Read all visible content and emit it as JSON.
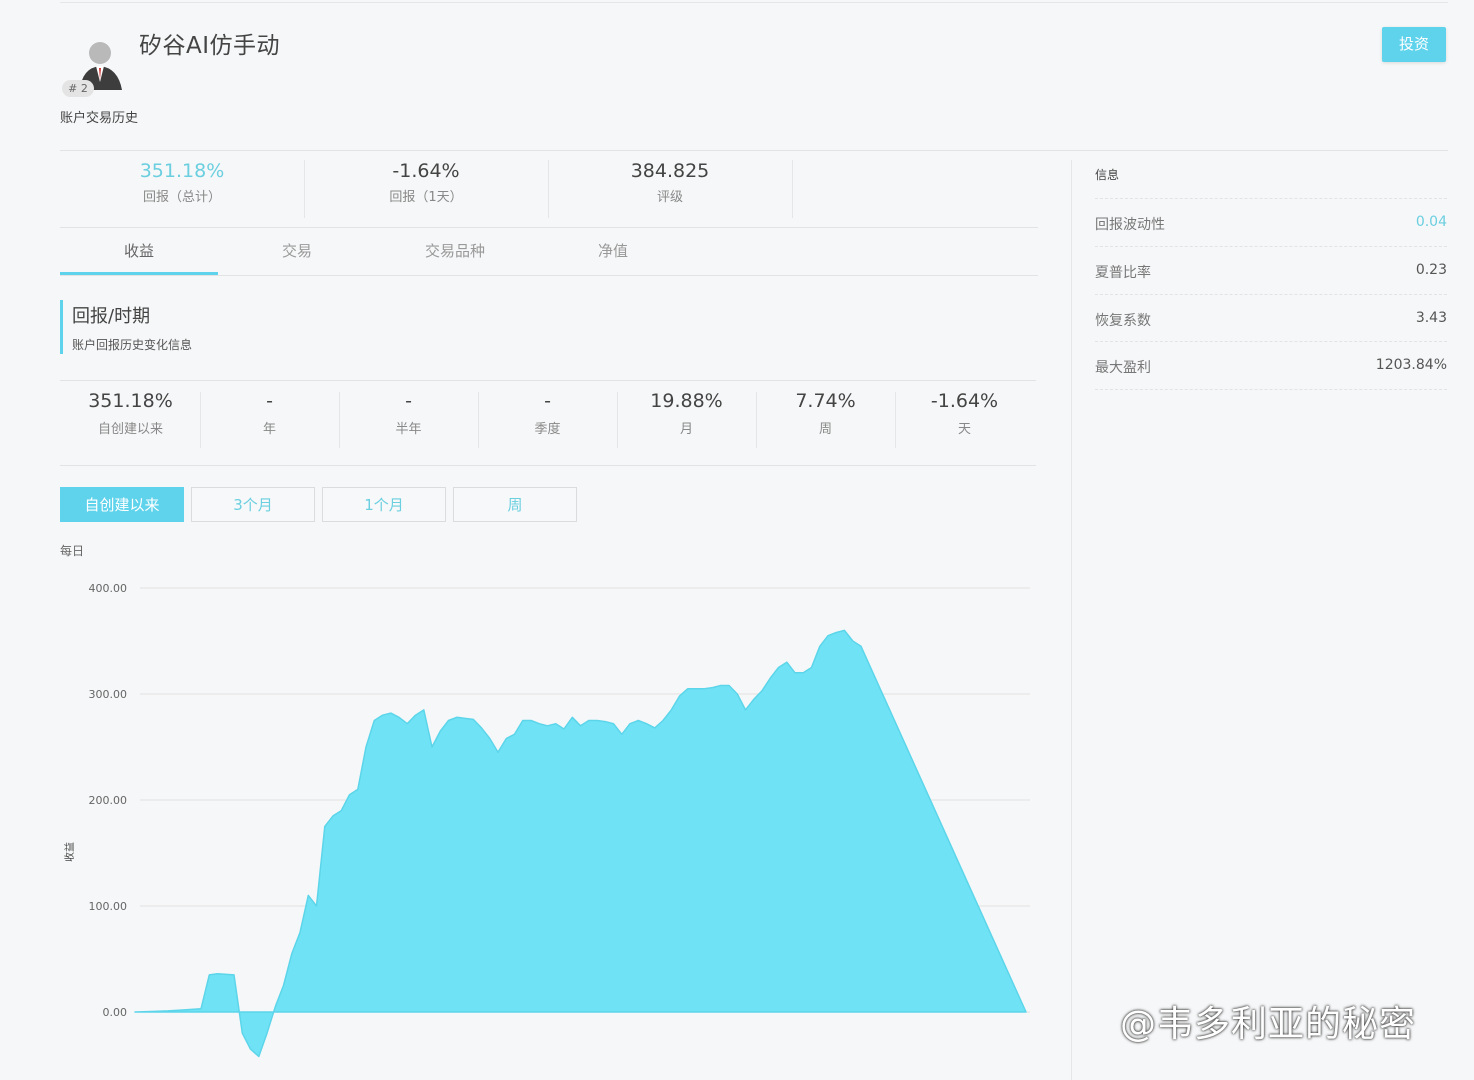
{
  "header": {
    "account_name": "矽谷AI仿手动",
    "rank": "# 2",
    "subtitle": "账户交易历史",
    "invest_label": "投资"
  },
  "stats": [
    {
      "value": "351.18%",
      "label": "回报（总计）"
    },
    {
      "value": "-1.64%",
      "label": "回报（1天）"
    },
    {
      "value": "384.825",
      "label": "评级"
    }
  ],
  "tabs": [
    "收益",
    "交易",
    "交易品种",
    "净值"
  ],
  "section": {
    "title": "回报/时期",
    "subtitle": "账户回报历史变化信息"
  },
  "periods": [
    {
      "value": "351.18%",
      "label": "自创建以来"
    },
    {
      "value": "-",
      "label": "年"
    },
    {
      "value": "-",
      "label": "半年"
    },
    {
      "value": "-",
      "label": "季度"
    },
    {
      "value": "19.88%",
      "label": "月"
    },
    {
      "value": "7.74%",
      "label": "周"
    },
    {
      "value": "-1.64%",
      "label": "天"
    }
  ],
  "range_buttons": [
    "自创建以来",
    "3个月",
    "1个月",
    "周"
  ],
  "chart_caption": "每日",
  "info": {
    "title": "信息",
    "rows": [
      {
        "key": "回报波动性",
        "value": "0.04"
      },
      {
        "key": "夏普比率",
        "value": "0.23"
      },
      {
        "key": "恢复系数",
        "value": "3.43"
      },
      {
        "key": "最大盈利",
        "value": "1203.84%"
      }
    ]
  },
  "watermark": "@韦多利亚的秘密",
  "colors": {
    "accent": "#5fd3ec",
    "fill": "#6fe3f5"
  },
  "chart_data": {
    "type": "area",
    "title": "",
    "xlabel": "",
    "ylabel": "收益",
    "ylim": [
      0,
      400
    ],
    "y_ticks": [
      "400.00",
      "300.00",
      "200.00",
      "100.00",
      "0.00"
    ],
    "grid": true,
    "x": [
      0,
      10,
      20,
      30,
      40,
      45,
      50,
      60,
      65,
      70,
      75,
      80,
      85,
      90,
      95,
      100,
      105,
      110,
      115,
      120,
      125,
      130,
      135,
      140,
      145,
      150,
      155,
      160,
      165,
      170,
      175,
      180,
      185,
      190,
      195,
      200,
      205,
      210,
      215,
      220,
      225,
      230,
      235,
      240,
      245,
      250,
      255,
      260,
      265,
      270,
      275,
      280,
      285,
      290,
      295,
      300,
      305,
      310,
      315,
      320,
      325,
      330,
      335,
      340,
      345,
      350,
      355,
      360,
      365,
      370,
      375,
      380,
      385,
      390,
      395,
      400,
      405,
      410,
      415,
      420,
      425,
      430,
      435,
      440,
      445,
      450,
      455,
      460,
      465,
      470,
      475,
      480,
      485,
      490,
      495,
      500,
      505,
      510,
      515,
      520,
      525,
      530,
      535,
      540
    ],
    "values": [
      0,
      0.5,
      1,
      2,
      3,
      35,
      36,
      35,
      -20,
      -35,
      -42,
      -20,
      5,
      25,
      55,
      75,
      110,
      100,
      175,
      185,
      190,
      205,
      210,
      250,
      275,
      280,
      282,
      278,
      272,
      280,
      285,
      250,
      265,
      275,
      278,
      277,
      276,
      268,
      258,
      245,
      258,
      262,
      275,
      275,
      272,
      270,
      272,
      267,
      278,
      270,
      275,
      275,
      274,
      272,
      262,
      272,
      275,
      272,
      268,
      275,
      285,
      298,
      305,
      305,
      305,
      306,
      308,
      308,
      300,
      285,
      295,
      303,
      315,
      325,
      330,
      320,
      320,
      325,
      345,
      355,
      358,
      360,
      350,
      345
    ]
  }
}
